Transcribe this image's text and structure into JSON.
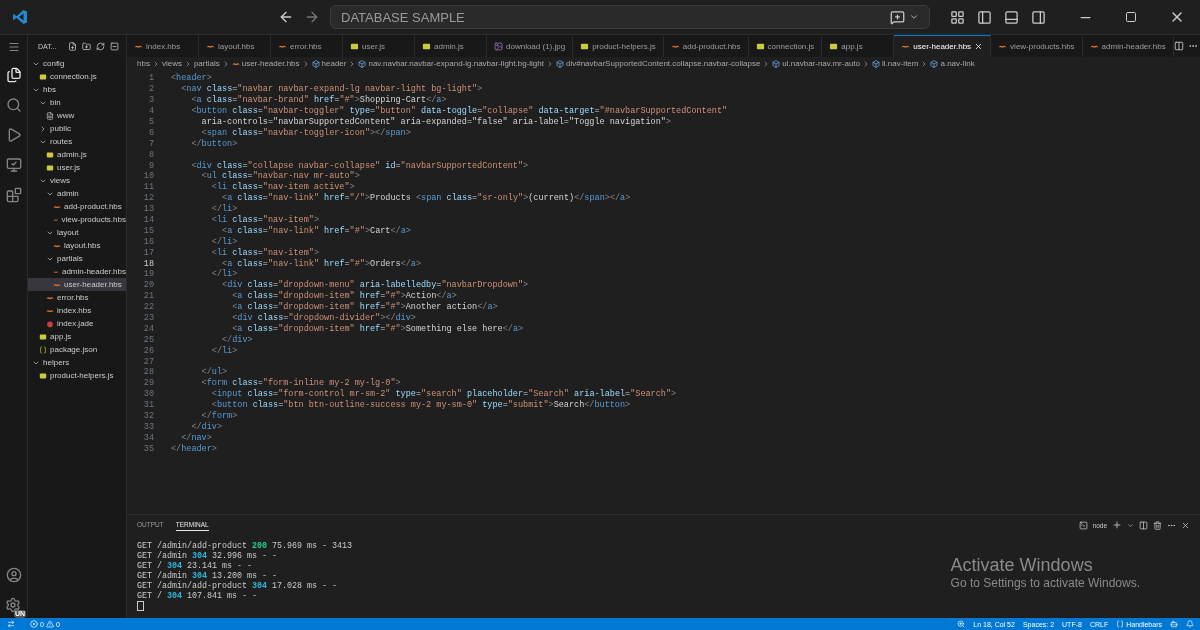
{
  "window": {
    "title": "DATABASE SAMPLE"
  },
  "explorer": {
    "title": "DAT...",
    "tree": [
      {
        "label": "config",
        "kind": "folder",
        "expanded": true,
        "selected": false,
        "children": [
          {
            "label": "connection.js",
            "kind": "js",
            "selected": false
          }
        ]
      },
      {
        "label": "hbs",
        "kind": "folder",
        "expanded": true,
        "selected": false,
        "children": [
          {
            "label": "bin",
            "kind": "folder",
            "expanded": true,
            "selected": false,
            "children": [
              {
                "label": "www",
                "kind": "file",
                "selected": false
              }
            ]
          },
          {
            "label": "public",
            "kind": "folder",
            "expanded": false,
            "selected": false
          },
          {
            "label": "routes",
            "kind": "folder",
            "expanded": true,
            "selected": false,
            "children": [
              {
                "label": "admin.js",
                "kind": "js",
                "selected": false
              },
              {
                "label": "user.js",
                "kind": "js",
                "selected": false
              }
            ]
          },
          {
            "label": "views",
            "kind": "folder",
            "expanded": true,
            "selected": false,
            "children": [
              {
                "label": "admin",
                "kind": "folder",
                "expanded": true,
                "selected": false,
                "children": [
                  {
                    "label": "add-product.hbs",
                    "kind": "hbs",
                    "selected": false
                  },
                  {
                    "label": "view-products.hbs",
                    "kind": "hbs",
                    "selected": false
                  }
                ]
              },
              {
                "label": "layout",
                "kind": "folder",
                "expanded": true,
                "selected": false,
                "children": [
                  {
                    "label": "layout.hbs",
                    "kind": "hbs",
                    "selected": false
                  }
                ]
              },
              {
                "label": "partials",
                "kind": "folder",
                "expanded": true,
                "selected": false,
                "children": [
                  {
                    "label": "admin-header.hbs",
                    "kind": "hbs",
                    "selected": false
                  },
                  {
                    "label": "user-header.hbs",
                    "kind": "hbs",
                    "selected": true
                  }
                ]
              },
              {
                "label": "error.hbs",
                "kind": "hbs",
                "selected": false
              },
              {
                "label": "index.hbs",
                "kind": "hbs",
                "selected": false
              },
              {
                "label": "index.jade",
                "kind": "jade",
                "selected": false
              }
            ]
          },
          {
            "label": "app.js",
            "kind": "js",
            "selected": false
          },
          {
            "label": "package.json",
            "kind": "json",
            "selected": false
          }
        ]
      },
      {
        "label": "helpers",
        "kind": "folder",
        "expanded": true,
        "selected": false,
        "children": [
          {
            "label": "product-helpers.js",
            "kind": "js",
            "selected": false
          }
        ]
      }
    ]
  },
  "tabs": [
    {
      "label": "index.hbs",
      "kind": "hbs",
      "selected": false
    },
    {
      "label": "layout.hbs",
      "kind": "hbs",
      "selected": false
    },
    {
      "label": "error.hbs",
      "kind": "hbs",
      "selected": false
    },
    {
      "label": "user.js",
      "kind": "js",
      "selected": false
    },
    {
      "label": "admin.js",
      "kind": "js",
      "selected": false
    },
    {
      "label": "download (1).jpg",
      "kind": "image",
      "selected": false
    },
    {
      "label": "product-helpers.js",
      "kind": "js",
      "selected": false
    },
    {
      "label": "add-product.hbs",
      "kind": "hbs",
      "selected": false
    },
    {
      "label": "connection.js",
      "kind": "js",
      "selected": false
    },
    {
      "label": "app.js",
      "kind": "js",
      "selected": false
    },
    {
      "label": "user-header.hbs",
      "kind": "hbs",
      "selected": true
    },
    {
      "label": "view-products.hbs",
      "kind": "hbs",
      "selected": false
    },
    {
      "label": "admin-header.hbs",
      "kind": "hbs",
      "selected": false
    }
  ],
  "breadcrumbs": [
    {
      "label": "hbs",
      "kind": "folder"
    },
    {
      "label": "views",
      "kind": "folder"
    },
    {
      "label": "partials",
      "kind": "folder"
    },
    {
      "label": "user-header.hbs",
      "kind": "hbs"
    },
    {
      "label": "header",
      "kind": "element"
    },
    {
      "label": "nav.navbar.navbar-expand-lg.navbar-light.bg-light",
      "kind": "element"
    },
    {
      "label": "div#navbarSupportedContent.collapse.navbar-collapse",
      "kind": "element"
    },
    {
      "label": "ul.navbar-nav.mr-auto",
      "kind": "element"
    },
    {
      "label": "li.nav-item",
      "kind": "element"
    },
    {
      "label": "a.nav-link",
      "kind": "element"
    }
  ],
  "code": [
    {
      "number": "1",
      "text": "<header>",
      "active": false
    },
    {
      "number": "2",
      "text": "  <nav class=\"navbar navbar-expand-lg navbar-light bg-light\">",
      "active": false
    },
    {
      "number": "3",
      "text": "    <a class=\"navbar-brand\" href=\"#\">Shopping-Cart</a>",
      "active": false
    },
    {
      "number": "4",
      "text": "    <button class=\"navbar-toggler\" type=\"button\" data-toggle=\"collapse\" data-target=\"#navbarSupportedContent\"",
      "active": false
    },
    {
      "number": "5",
      "text": "      aria-controls=\"navbarSupportedContent\" aria-expanded=\"false\" aria-label=\"Toggle navigation\">",
      "active": false
    },
    {
      "number": "6",
      "text": "      <span class=\"navbar-toggler-icon\"></span>",
      "active": false
    },
    {
      "number": "7",
      "text": "    </button>",
      "active": false
    },
    {
      "number": "8",
      "active": false
    },
    {
      "number": "9",
      "text": "    <div class=\"collapse navbar-collapse\" id=\"navbarSupportedContent\">",
      "active": false
    },
    {
      "number": "10",
      "text": "      <ul class=\"navbar-nav mr-auto\">",
      "active": false
    },
    {
      "number": "11",
      "text": "        <li class=\"nav-item active\">",
      "active": false
    },
    {
      "number": "12",
      "text": "          <a class=\"nav-link\" href=\"/\">Products <span class=\"sr-only\">(current)</span></a>",
      "active": false
    },
    {
      "number": "13",
      "text": "        </li>",
      "active": false
    },
    {
      "number": "14",
      "text": "        <li class=\"nav-item\">",
      "active": false
    },
    {
      "number": "15",
      "text": "          <a class=\"nav-link\" href=\"#\">Cart</a>",
      "active": false
    },
    {
      "number": "16",
      "text": "        </li>",
      "active": false
    },
    {
      "number": "17",
      "text": "        <li class=\"nav-item\">",
      "active": false
    },
    {
      "number": "18",
      "text": "          <a class=\"nav-link\" href=\"#\">Orders</a>",
      "active": true
    },
    {
      "number": "19",
      "text": "        </li>",
      "active": false
    },
    {
      "number": "20",
      "text": "          <div class=\"dropdown-menu\" aria-labelledby=\"navbarDropdown\">",
      "active": false
    },
    {
      "number": "21",
      "text": "            <a class=\"dropdown-item\" href=\"#\">Action</a>",
      "active": false
    },
    {
      "number": "22",
      "text": "            <a class=\"dropdown-item\" href=\"#\">Another action</a>",
      "active": false
    },
    {
      "number": "23",
      "text": "            <div class=\"dropdown-divider\"></div>",
      "active": false
    },
    {
      "number": "24",
      "text": "            <a class=\"dropdown-item\" href=\"#\">Something else here</a>",
      "active": false
    },
    {
      "number": "25",
      "text": "          </div>",
      "active": false
    },
    {
      "number": "26",
      "text": "        </li>",
      "active": false
    },
    {
      "number": "27",
      "active": false
    },
    {
      "number": "28",
      "text": "      </ul>",
      "active": false
    },
    {
      "number": "29",
      "text": "      <form class=\"form-inline my-2 my-lg-0\">",
      "active": false
    },
    {
      "number": "30",
      "text": "        <input class=\"form-control mr-sm-2\" type=\"search\" placeholder=\"Search\" aria-label=\"Search\">",
      "active": false
    },
    {
      "number": "31",
      "text": "        <button class=\"btn btn-outline-success my-2 my-sm-0\" type=\"submit\">Search</button>",
      "active": false
    },
    {
      "number": "32",
      "text": "      </form>",
      "active": false
    },
    {
      "number": "33",
      "text": "    </div>",
      "active": false
    },
    {
      "number": "34",
      "text": "  </nav>",
      "active": false
    },
    {
      "number": "35",
      "text": "</header>",
      "active": false
    }
  ],
  "panel": {
    "tabs": [
      {
        "label": "OUTPUT",
        "selected": false
      },
      {
        "label": "TERMINAL",
        "selected": true
      }
    ],
    "shell": "node",
    "terminal": [
      {
        "request": "GET /admin/add-product",
        "status": "200",
        "color": "#23d18b",
        "rest": "75.969 ms - 3413"
      },
      {
        "request": "GET /admin",
        "status": "304",
        "color": "#29b8db",
        "rest": "32.996 ms - -"
      },
      {
        "request": "GET /",
        "status": "304",
        "color": "#29b8db",
        "rest": "23.141 ms - -"
      },
      {
        "request": "GET /admin",
        "status": "304",
        "color": "#29b8db",
        "rest": "13.200 ms - -"
      },
      {
        "request": "GET /admin/add-product",
        "status": "304",
        "color": "#29b8db",
        "rest": "17.028 ms - -"
      },
      {
        "request": "GET /",
        "status": "304",
        "color": "#29b8db",
        "rest": "107.841 ms - -"
      }
    ]
  },
  "activation": {
    "title": "Activate Windows",
    "message": "Go to Settings to activate Windows."
  },
  "status_bar": {
    "errors": "0",
    "warnings": "0",
    "items": [
      "Ln 18, Col 52",
      "Spaces: 2",
      "UTF-8",
      "CRLF"
    ],
    "language": "Handlebars",
    "account_badge": "UN"
  }
}
